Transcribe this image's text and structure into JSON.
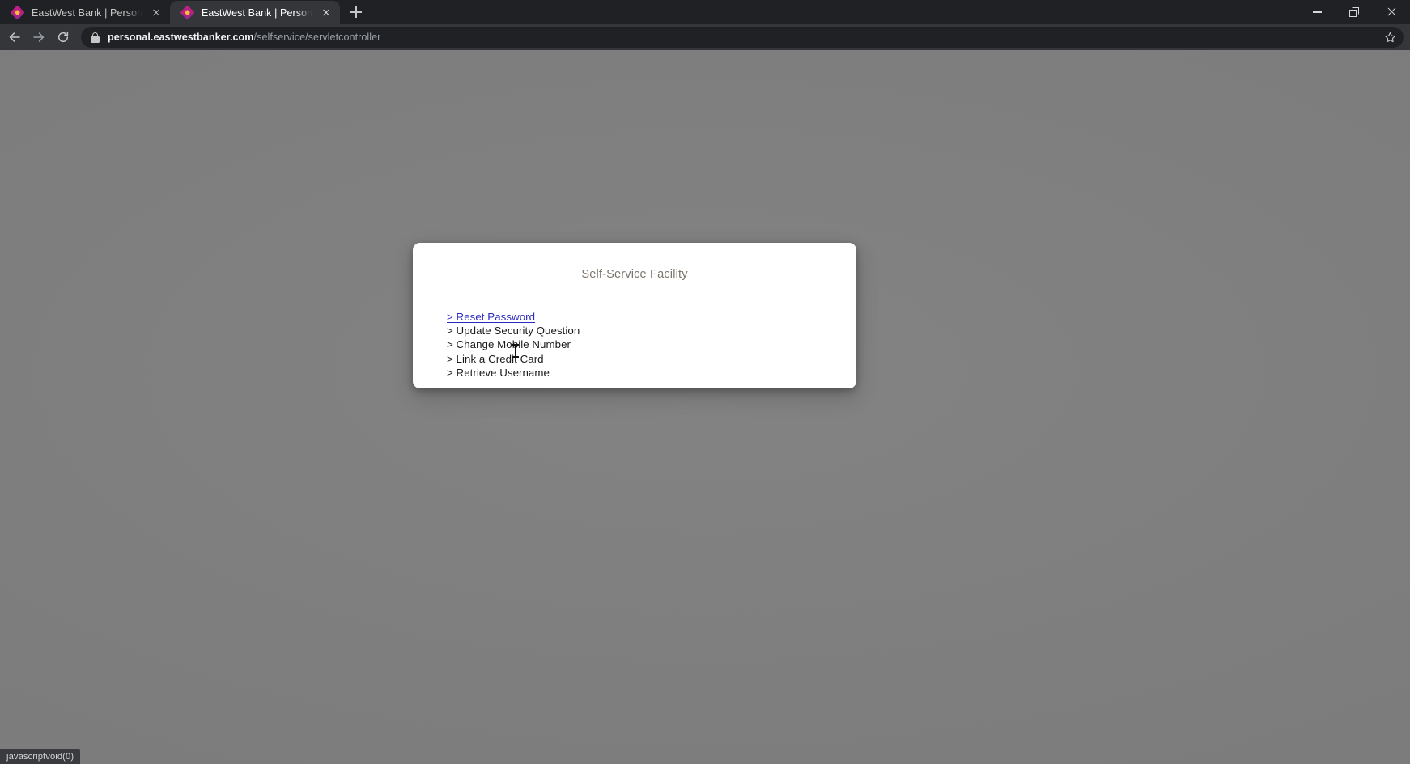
{
  "browser": {
    "tabs": [
      {
        "title": "EastWest Bank | Personal Banking",
        "favicon": "eastwest-diamond-icon",
        "close_label": "×",
        "active": false
      },
      {
        "title": "EastWest Bank | Personal Banking",
        "favicon": "eastwest-diamond-icon",
        "close_label": "×",
        "active": true
      }
    ],
    "new_tab_label": "+",
    "window_controls": {
      "minimize": "−",
      "maximize": "❐",
      "close": "×"
    },
    "toolbar": {
      "back_icon": "back-arrow-icon",
      "forward_icon": "forward-arrow-icon",
      "reload_icon": "reload-icon",
      "security_icon": "lock-icon",
      "bookmark_icon": "star-icon",
      "url_host": "personal.eastwestbanker.com",
      "url_path": "/selfservice/servletcontroller",
      "url_full": "personal.eastwestbanker.com/selfservice/servletcontroller"
    }
  },
  "page": {
    "card": {
      "title": "Self-Service Facility",
      "links": [
        {
          "label": "> Reset Password",
          "hovered": true
        },
        {
          "label": "> Update Security Question",
          "hovered": false
        },
        {
          "label": "> Change Mobile Number",
          "hovered": false
        },
        {
          "label": "> Link a Credit Card",
          "hovered": false
        },
        {
          "label": "> Retrieve Username",
          "hovered": false
        }
      ]
    },
    "status_bar": "javascriptvoid(0)"
  },
  "colors": {
    "page_background": "#7d7d7d",
    "card_background": "#ffffff",
    "title_text": "#7d756d",
    "link_text": "#1a1a1a",
    "hover_link_text": "#2a2ac0",
    "chrome_tabstrip": "#202124",
    "chrome_toolbar": "#35363a",
    "omnibox": "#202124",
    "favicon_magenta": "#c0208a",
    "favicon_core": "#fbbc36"
  }
}
